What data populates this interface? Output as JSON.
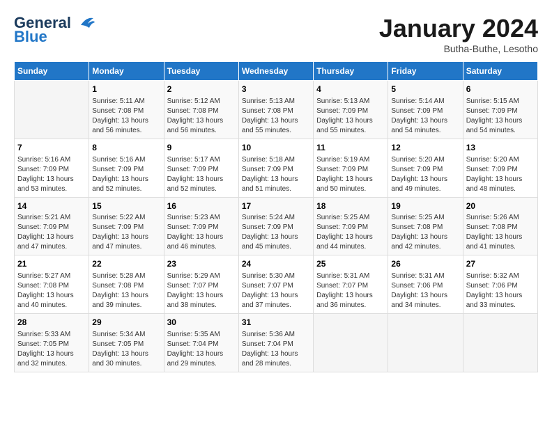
{
  "header": {
    "logo_line1": "General",
    "logo_line2": "Blue",
    "month": "January 2024",
    "location": "Butha-Buthe, Lesotho"
  },
  "weekdays": [
    "Sunday",
    "Monday",
    "Tuesday",
    "Wednesday",
    "Thursday",
    "Friday",
    "Saturday"
  ],
  "weeks": [
    [
      {
        "day": "",
        "info": ""
      },
      {
        "day": "1",
        "info": "Sunrise: 5:11 AM\nSunset: 7:08 PM\nDaylight: 13 hours\nand 56 minutes."
      },
      {
        "day": "2",
        "info": "Sunrise: 5:12 AM\nSunset: 7:08 PM\nDaylight: 13 hours\nand 56 minutes."
      },
      {
        "day": "3",
        "info": "Sunrise: 5:13 AM\nSunset: 7:08 PM\nDaylight: 13 hours\nand 55 minutes."
      },
      {
        "day": "4",
        "info": "Sunrise: 5:13 AM\nSunset: 7:09 PM\nDaylight: 13 hours\nand 55 minutes."
      },
      {
        "day": "5",
        "info": "Sunrise: 5:14 AM\nSunset: 7:09 PM\nDaylight: 13 hours\nand 54 minutes."
      },
      {
        "day": "6",
        "info": "Sunrise: 5:15 AM\nSunset: 7:09 PM\nDaylight: 13 hours\nand 54 minutes."
      }
    ],
    [
      {
        "day": "7",
        "info": "Sunrise: 5:16 AM\nSunset: 7:09 PM\nDaylight: 13 hours\nand 53 minutes."
      },
      {
        "day": "8",
        "info": "Sunrise: 5:16 AM\nSunset: 7:09 PM\nDaylight: 13 hours\nand 52 minutes."
      },
      {
        "day": "9",
        "info": "Sunrise: 5:17 AM\nSunset: 7:09 PM\nDaylight: 13 hours\nand 52 minutes."
      },
      {
        "day": "10",
        "info": "Sunrise: 5:18 AM\nSunset: 7:09 PM\nDaylight: 13 hours\nand 51 minutes."
      },
      {
        "day": "11",
        "info": "Sunrise: 5:19 AM\nSunset: 7:09 PM\nDaylight: 13 hours\nand 50 minutes."
      },
      {
        "day": "12",
        "info": "Sunrise: 5:20 AM\nSunset: 7:09 PM\nDaylight: 13 hours\nand 49 minutes."
      },
      {
        "day": "13",
        "info": "Sunrise: 5:20 AM\nSunset: 7:09 PM\nDaylight: 13 hours\nand 48 minutes."
      }
    ],
    [
      {
        "day": "14",
        "info": "Sunrise: 5:21 AM\nSunset: 7:09 PM\nDaylight: 13 hours\nand 47 minutes."
      },
      {
        "day": "15",
        "info": "Sunrise: 5:22 AM\nSunset: 7:09 PM\nDaylight: 13 hours\nand 47 minutes."
      },
      {
        "day": "16",
        "info": "Sunrise: 5:23 AM\nSunset: 7:09 PM\nDaylight: 13 hours\nand 46 minutes."
      },
      {
        "day": "17",
        "info": "Sunrise: 5:24 AM\nSunset: 7:09 PM\nDaylight: 13 hours\nand 45 minutes."
      },
      {
        "day": "18",
        "info": "Sunrise: 5:25 AM\nSunset: 7:09 PM\nDaylight: 13 hours\nand 44 minutes."
      },
      {
        "day": "19",
        "info": "Sunrise: 5:25 AM\nSunset: 7:08 PM\nDaylight: 13 hours\nand 42 minutes."
      },
      {
        "day": "20",
        "info": "Sunrise: 5:26 AM\nSunset: 7:08 PM\nDaylight: 13 hours\nand 41 minutes."
      }
    ],
    [
      {
        "day": "21",
        "info": "Sunrise: 5:27 AM\nSunset: 7:08 PM\nDaylight: 13 hours\nand 40 minutes."
      },
      {
        "day": "22",
        "info": "Sunrise: 5:28 AM\nSunset: 7:08 PM\nDaylight: 13 hours\nand 39 minutes."
      },
      {
        "day": "23",
        "info": "Sunrise: 5:29 AM\nSunset: 7:07 PM\nDaylight: 13 hours\nand 38 minutes."
      },
      {
        "day": "24",
        "info": "Sunrise: 5:30 AM\nSunset: 7:07 PM\nDaylight: 13 hours\nand 37 minutes."
      },
      {
        "day": "25",
        "info": "Sunrise: 5:31 AM\nSunset: 7:07 PM\nDaylight: 13 hours\nand 36 minutes."
      },
      {
        "day": "26",
        "info": "Sunrise: 5:31 AM\nSunset: 7:06 PM\nDaylight: 13 hours\nand 34 minutes."
      },
      {
        "day": "27",
        "info": "Sunrise: 5:32 AM\nSunset: 7:06 PM\nDaylight: 13 hours\nand 33 minutes."
      }
    ],
    [
      {
        "day": "28",
        "info": "Sunrise: 5:33 AM\nSunset: 7:05 PM\nDaylight: 13 hours\nand 32 minutes."
      },
      {
        "day": "29",
        "info": "Sunrise: 5:34 AM\nSunset: 7:05 PM\nDaylight: 13 hours\nand 30 minutes."
      },
      {
        "day": "30",
        "info": "Sunrise: 5:35 AM\nSunset: 7:04 PM\nDaylight: 13 hours\nand 29 minutes."
      },
      {
        "day": "31",
        "info": "Sunrise: 5:36 AM\nSunset: 7:04 PM\nDaylight: 13 hours\nand 28 minutes."
      },
      {
        "day": "",
        "info": ""
      },
      {
        "day": "",
        "info": ""
      },
      {
        "day": "",
        "info": ""
      }
    ]
  ]
}
